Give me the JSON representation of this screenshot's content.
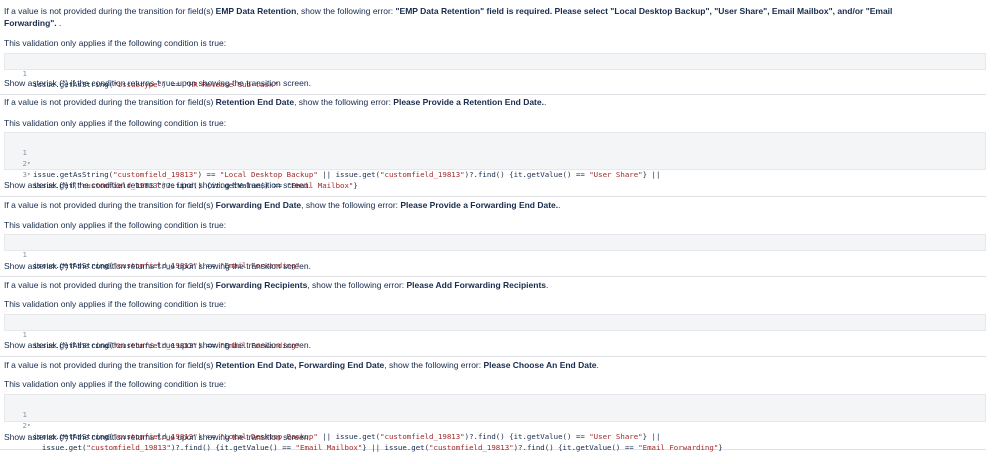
{
  "blocks": [
    {
      "prefix": "If a value is not provided during the transition for field(s) ",
      "fields": "EMP Data Retention",
      "middle": ", show the following error: ",
      "error_line1": "\"EMP Data Retention\" field is required. Please select \"Local Desktop Backup\", \"User Share\", Email Mailbox\", and/or \"Email",
      "error_line2": "Forwarding\".",
      "error_suffix": ".",
      "condition_note": "This validation only applies if the following condition is true:",
      "code": [
        {
          "n": "1",
          "fold": "",
          "text": "issue.getAsString(\"issuetype\") == \"HR Release Sub-task\""
        }
      ],
      "asterisk_pre": "Show asterisk (*) if the condition returns ",
      "asterisk_code": "true",
      "asterisk_post": " upon showing the transition screen."
    },
    {
      "prefix": "If a value is not provided during the transition for field(s) ",
      "fields": "Retention End Date",
      "middle": ", show the following error: ",
      "error_line1": "Please Provide a Retention End Date.",
      "error_suffix": ".",
      "condition_note": "This validation only applies if the following condition is true:",
      "code": [
        {
          "n": "1",
          "fold": "▾",
          "text": "issue.getAsString(\"customfield_19813\") == \"Local Desktop Backup\" || issue.get(\"customfield_19813\")?.find() {it.getValue() == \"User Share\"} ||"
        },
        {
          "n": "2",
          "fold": "▾",
          "text": "issue.get(\"customfield_19813\")?.find() {it.getValue() == \"Email Mailbox\"}"
        },
        {
          "n": "3",
          "fold": "",
          "text": ""
        }
      ],
      "asterisk_pre": "Show asterisk (*) if the condition returns ",
      "asterisk_code": "true",
      "asterisk_post": " upon showing the transition screen."
    },
    {
      "prefix": "If a value is not provided during the transition for field(s) ",
      "fields": "Forwarding End Date",
      "middle": ", show the following error: ",
      "error_line1": "Please Provide a Forwarding End Date.",
      "error_suffix": ".",
      "condition_note": "This validation only applies if the following condition is true:",
      "code": [
        {
          "n": "1",
          "fold": "",
          "text": "issue.getAsString(\"customfield_19813\") == \"Email Forwarding\""
        }
      ],
      "asterisk_pre": "Show asterisk (*) if the condition returns ",
      "asterisk_code": "true",
      "asterisk_post": " upon showing the transition screen."
    },
    {
      "prefix": "If a value is not provided during the transition for field(s) ",
      "fields": "Forwarding Recipients",
      "middle": ", show the following error: ",
      "error_line1": "Please Add Forwarding Recipients",
      "error_suffix": ".",
      "condition_note": "This validation only applies if the following condition is true:",
      "code": [
        {
          "n": "1",
          "fold": "",
          "text": "issue.getAsString(\"customfield_19813\") == \"Email Forwarding\""
        }
      ],
      "asterisk_pre": "Show asterisk (*) if the condition returns ",
      "asterisk_code": "true",
      "asterisk_post": " upon showing the transition screen."
    },
    {
      "prefix": "If a value is not provided during the transition for field(s) ",
      "fields": "Retention End Date, Forwarding End Date",
      "middle": ", show the following error: ",
      "error_line1": "Please Choose An End Date",
      "error_suffix": ".",
      "condition_note": "This validation only applies if the following condition is true:",
      "code": [
        {
          "n": "1",
          "fold": "▾",
          "text": "issue.getAsString(\"customfield_19813\") == \"Local Desktop Backup\" || issue.get(\"customfield_19813\")?.find() {it.getValue() == \"User Share\"} ||"
        },
        {
          "n": "2",
          "fold": "▾",
          "text": "  issue.get(\"customfield_19813\")?.find() {it.getValue() == \"Email Mailbox\"} || issue.get(\"customfield_19813\")?.find() {it.getValue() == \"Email Forwarding\"}"
        }
      ],
      "asterisk_pre": "Show asterisk (*) if the condition returns ",
      "asterisk_code": "true",
      "asterisk_post": " upon showing the transition screen."
    }
  ]
}
